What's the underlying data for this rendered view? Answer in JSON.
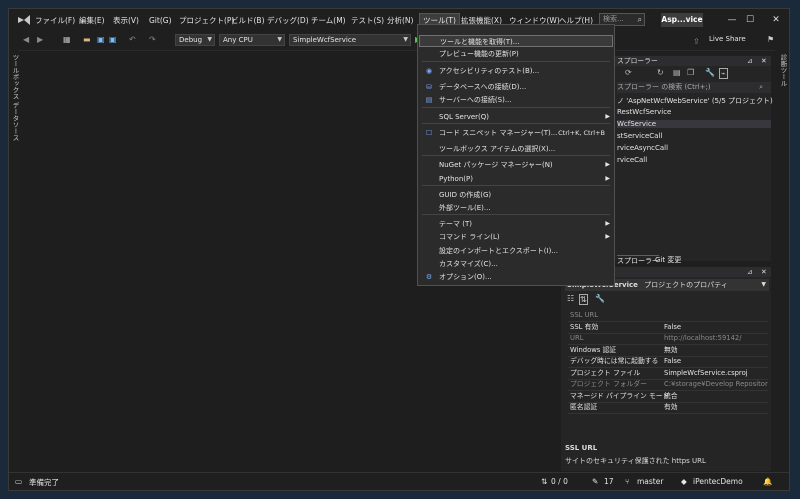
{
  "titlebar": {
    "menus": [
      "ファイル(F)",
      "編集(E)",
      "表示(V)",
      "Git(G)",
      "プロジェクト(P)",
      "ビルド(B)",
      "デバッグ(D)",
      "チーム(M)",
      "テスト(S)",
      "分析(N)",
      "ツール(T)",
      "拡張機能(X)",
      "ウィンドウ(W)",
      "ヘルプ(H)"
    ],
    "search_placeholder": "検索...",
    "solution_name": "Asp...vice"
  },
  "toolbar": {
    "config": "Debug",
    "platform": "Any CPU",
    "startup_project": "SimpleWcfService",
    "live_share": "Live Share"
  },
  "left_strip": {
    "toolbox": "ツールボックス",
    "datasources": "データソース"
  },
  "right_strip": {
    "label": "診断ツール"
  },
  "tools_menu": {
    "items": [
      {
        "label": "ツールと機能を取得(T)...",
        "shortcut": "",
        "submenu": false,
        "icon": ""
      },
      {
        "label": "プレビュー機能の更新(P)",
        "shortcut": "",
        "submenu": false,
        "icon": ""
      },
      {
        "label": "アクセシビリティのテスト(B)...",
        "shortcut": "",
        "submenu": false,
        "icon": "◉"
      },
      {
        "label": "データベースへの接続(D)...",
        "shortcut": "",
        "submenu": false,
        "icon": "⛁"
      },
      {
        "label": "サーバーへの接続(S)...",
        "shortcut": "",
        "submenu": false,
        "icon": "▤"
      },
      {
        "label": "SQL Server(Q)",
        "shortcut": "",
        "submenu": true,
        "icon": ""
      },
      {
        "label": "コード スニペット マネージャー(T)...",
        "shortcut": "Ctrl+K, Ctrl+B",
        "submenu": false,
        "icon": "☐"
      },
      {
        "label": "ツールボックス アイテムの選択(X)...",
        "shortcut": "",
        "submenu": false,
        "icon": ""
      },
      {
        "label": "NuGet パッケージ マネージャー(N)",
        "shortcut": "",
        "submenu": true,
        "icon": ""
      },
      {
        "label": "Python(P)",
        "shortcut": "",
        "submenu": true,
        "icon": ""
      },
      {
        "label": "GUID の作成(G)",
        "shortcut": "",
        "submenu": false,
        "icon": ""
      },
      {
        "label": "外部ツール(E)...",
        "shortcut": "",
        "submenu": false,
        "icon": ""
      },
      {
        "label": "テーマ (T)",
        "shortcut": "",
        "submenu": true,
        "icon": ""
      },
      {
        "label": "コマンド ライン(L)",
        "shortcut": "",
        "submenu": true,
        "icon": ""
      },
      {
        "label": "設定のインポートとエクスポート(I)...",
        "shortcut": "",
        "submenu": false,
        "icon": ""
      },
      {
        "label": "カスタマイズ(C)...",
        "shortcut": "",
        "submenu": false,
        "icon": ""
      },
      {
        "label": "オプション(O)...",
        "shortcut": "",
        "submenu": false,
        "icon": "⚙"
      }
    ]
  },
  "solution_explorer": {
    "title": "スプローラー",
    "search": "スプローラー の検索 (Ctrl+;)",
    "root": "ノ 'AspNetWcfWebService' (5/5 プロジェクト)",
    "items": [
      "RestWcfService",
      "WcfService",
      "stServiceCall",
      "rviceAsyncCall",
      "rviceCall"
    ],
    "tab1": "スプローラー",
    "tab2": "Git 変更"
  },
  "properties": {
    "object": "SimpleWcfService",
    "object_type": "プロジェクトのプロパティ",
    "rows": [
      {
        "name": "SSL URL",
        "value": "",
        "dim": true
      },
      {
        "name": "SSL 有効",
        "value": "False",
        "dim": false
      },
      {
        "name": "URL",
        "value": "http://localhost:59142/",
        "dim": true
      },
      {
        "name": "Windows 認証",
        "value": "無効",
        "dim": false
      },
      {
        "name": "デバッグ時には常に起動する",
        "value": "False",
        "dim": false
      },
      {
        "name": "プロジェクト ファイル",
        "value": "SimpleWcfService.csproj",
        "dim": false
      },
      {
        "name": "プロジェクト フォルダー",
        "value": "C:¥storage¥Develop Repository¥i",
        "dim": true
      },
      {
        "name": "マネージド パイプライン モード",
        "value": "統合",
        "dim": false
      },
      {
        "name": "匿名認証",
        "value": "有効",
        "dim": false
      }
    ],
    "desc_title": "SSL URL",
    "desc_text": "サイトのセキュリティ保護された https URL"
  },
  "statusbar": {
    "ready": "準備完了",
    "changes": "0 / 0",
    "commits": "17",
    "branch": "master",
    "repo": "iPentecDemo"
  }
}
